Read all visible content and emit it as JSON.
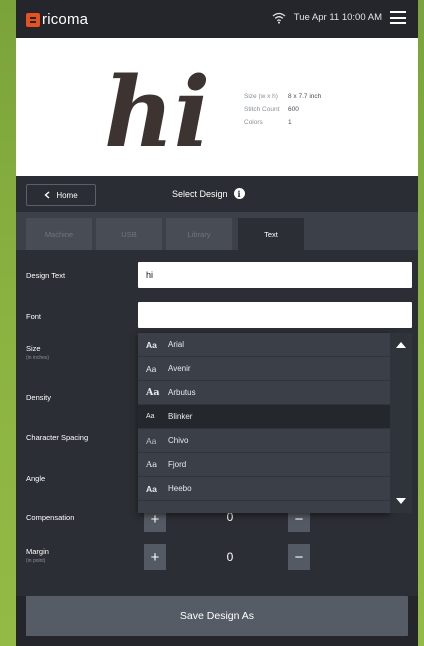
{
  "header": {
    "brand": "ricoma",
    "datetime": "Tue Apr 11  10:00 AM",
    "icons": [
      "wifi-icon",
      "menu-icon"
    ]
  },
  "preview": {
    "design_text": "hi",
    "specs": [
      {
        "label": "Size (w x h)",
        "value": "8 x 7.7 inch"
      },
      {
        "label": "Stitch Count",
        "value": "600"
      },
      {
        "label": "Colors",
        "value": "1"
      }
    ]
  },
  "nav": {
    "home_label": "Home",
    "title": "Select Design",
    "info_glyph": "i"
  },
  "tabs": [
    {
      "label": "Machine",
      "active": false
    },
    {
      "label": "USB",
      "active": false
    },
    {
      "label": "Library",
      "active": false
    },
    {
      "label": "Text",
      "active": true
    }
  ],
  "form": {
    "design_text_label": "Design Text",
    "design_text_value": "hi",
    "font_label": "Font",
    "font_value": "",
    "size_label": "Size",
    "size_sublabel": "(in inches)",
    "density_label": "Density",
    "char_spacing_label": "Character Spacing",
    "angle_label": "Angle",
    "compensation_label": "Compensation",
    "compensation_value": "0",
    "margin_label": "Margin",
    "margin_sublabel": "(in point)",
    "margin_value": "0",
    "plus_glyph": "+",
    "minus_glyph": "−"
  },
  "font_dropdown": {
    "aa_glyph": "Aa",
    "options": [
      {
        "name": "Arial",
        "selected": false
      },
      {
        "name": "Avenir",
        "selected": false
      },
      {
        "name": "Arbutus",
        "selected": false
      },
      {
        "name": "Blinker",
        "selected": true
      },
      {
        "name": "Chivo",
        "selected": false
      },
      {
        "name": "Fjord",
        "selected": false
      },
      {
        "name": "Heebo",
        "selected": false
      }
    ]
  },
  "footer": {
    "save_label": "Save Design As"
  }
}
